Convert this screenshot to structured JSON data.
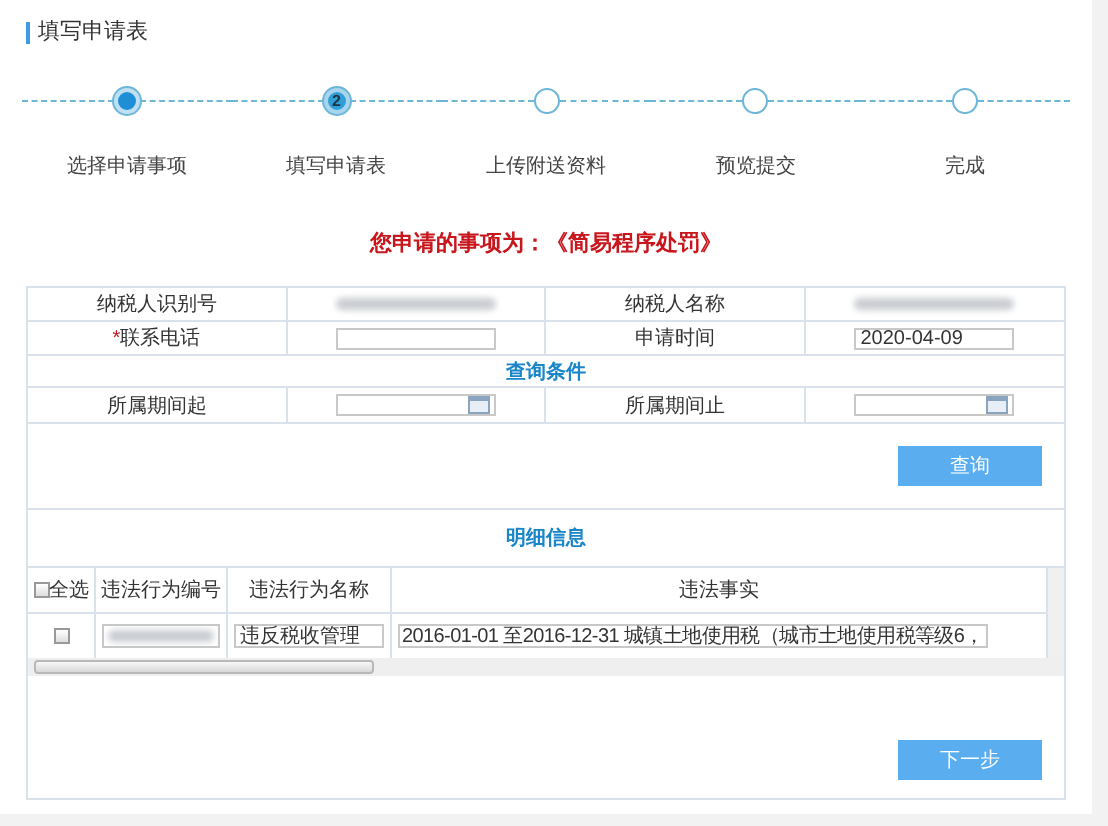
{
  "section_title": "填写申请表",
  "steps": [
    {
      "label": "选择申请事项",
      "done": true,
      "current": false
    },
    {
      "label": "填写申请表",
      "done": false,
      "current": true,
      "number": "2"
    },
    {
      "label": "上传附送资料",
      "done": false,
      "current": false
    },
    {
      "label": "预览提交",
      "done": false,
      "current": false
    },
    {
      "label": "完成",
      "done": false,
      "current": false
    }
  ],
  "notice": "您申请的事项为：《简易程序处罚》",
  "form": {
    "taxpayer_id_label": "纳税人识别号",
    "taxpayer_name_label": "纳税人名称",
    "phone_required_mark": "*",
    "phone_label": "联系电话",
    "apply_date_label": "申请时间",
    "apply_date_value": "2020-04-09"
  },
  "query": {
    "title": "查询条件",
    "period_start_label": "所属期间起",
    "period_end_label": "所属期间止",
    "button": "查询"
  },
  "details": {
    "title": "明细信息",
    "select_all": {
      "label": "全选",
      "checked": false
    },
    "columns": [
      "违法行为编号",
      "违法行为名称",
      "违法事实"
    ],
    "rows": [
      {
        "checked": false,
        "name": "违反税收管理",
        "fact": "2016-01-01 至2016-12-31 城镇土地使用税（城市土地使用税等级6，"
      }
    ]
  },
  "next_button": "下一步"
}
